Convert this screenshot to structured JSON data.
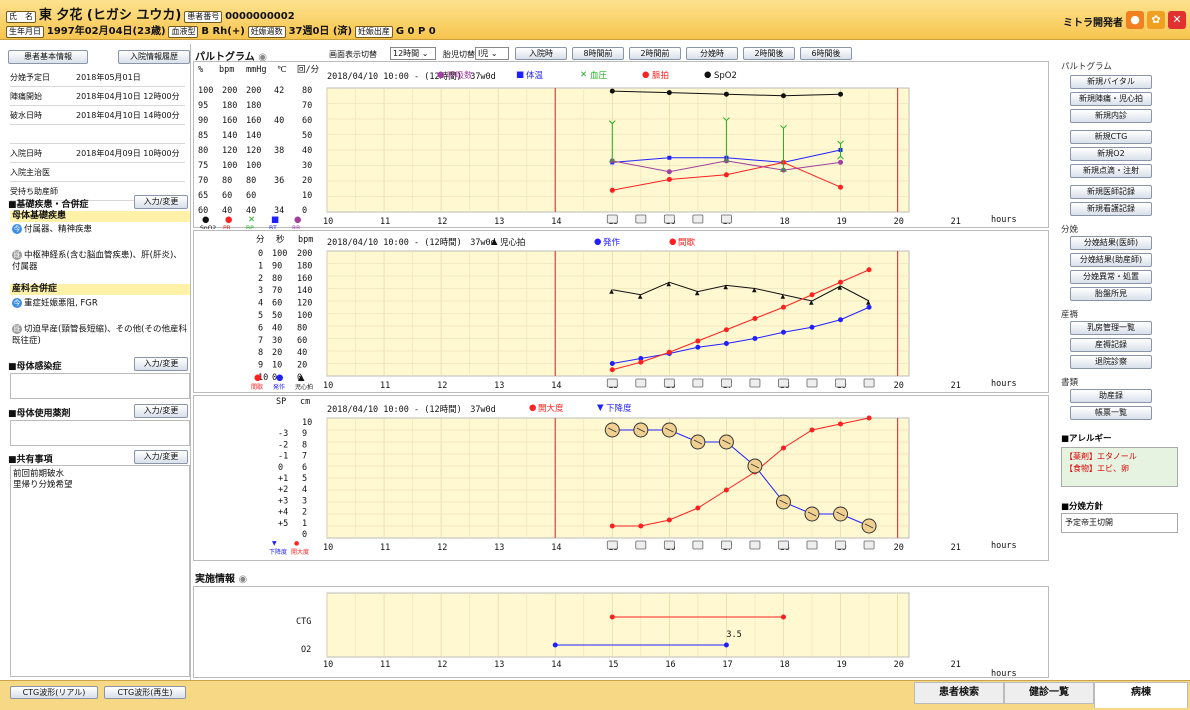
{
  "header": {
    "name_tag": "氏　名",
    "name": "東 夕花 (ヒガシ ユウカ)",
    "patient_no_tag": "患者番号",
    "patient_no": "0000000002",
    "dob_tag": "生年月日",
    "dob": "1997年02月04日(23歳)",
    "blood_tag": "血液型",
    "blood": "B Rh(+)",
    "weeks_tag": "妊娠週数",
    "weeks": "37週0日 (済)",
    "parity_tag": "妊娠出産",
    "parity": "G 0 P 0",
    "user": "ミトラ開発者"
  },
  "left": {
    "btn_basic": "患者基本情報",
    "btn_history": "入院情報履歴",
    "info": [
      {
        "label": "分娩予定日",
        "value": "2018年05月01日"
      },
      {
        "label": "陣痛開始",
        "value": "2018年04月10日 12時00分"
      },
      {
        "label": "破水日時",
        "value": "2018年04月10日 14時00分"
      },
      {
        "label": "",
        "value": ""
      },
      {
        "label": "入院日時",
        "value": "2018年04月09日 10時00分"
      },
      {
        "label": "入院主治医",
        "value": ""
      },
      {
        "label": "受持ち助産師",
        "value": ""
      }
    ],
    "sec_disease": "■基礎疾患・合併症",
    "btn_edit": "入力/変更",
    "maternal_title": "母体基礎疾患",
    "maternal_1": "付属器、精神疾患",
    "maternal_2": "中枢神経系(含む脳血管疾患)、肝(肝炎)、付属器",
    "obst_title": "産科合併症",
    "obst_1": "重症妊娠悪阻, FGR",
    "obst_2": "切迫早産(頸管長短縮)、その他(その他産科既往症)",
    "sec_infection": "■母体感染症",
    "sec_drug": "■母体使用薬剤",
    "sec_shared": "■共有事項",
    "shared_1": "前回前期破水",
    "shared_2": "里帰り分娩希望",
    "ic_now": "今",
    "ic_past": "既"
  },
  "toolbar": {
    "title": "パルトグラム",
    "range_label": "画面表示切替",
    "range_value": "12時間",
    "fetal_label": "胎児切替",
    "fetal_value": "Ⅰ児",
    "buttons": [
      "入院時",
      "8時間前",
      "2時間前",
      "分娩時",
      "2時間後",
      "6時間後"
    ]
  },
  "chart_common": {
    "header": "2018/04/10 10:00 - (12時間)　37w0d",
    "xticks": [
      "10",
      "11",
      "12",
      "13",
      "14",
      "15",
      "16",
      "17",
      "18",
      "19",
      "20",
      "21"
    ],
    "hours": "hours"
  },
  "chart_data": [
    {
      "type": "line",
      "legend": [
        "呼吸数",
        "体温",
        "血圧",
        "脈拍",
        "SpO2"
      ],
      "axes_units": [
        "%",
        "bpm",
        "mmHg",
        "℃",
        "回/分"
      ],
      "axis_spo2": [
        "100",
        "95",
        "90",
        "85",
        "80",
        "75",
        "70",
        "65",
        "60"
      ],
      "axis_pr": [
        "200",
        "180",
        "160",
        "140",
        "120",
        "100",
        "80",
        "60",
        "40"
      ],
      "axis_bp": [
        "200",
        "180",
        "160",
        "140",
        "120",
        "100",
        "80",
        "60",
        "40"
      ],
      "axis_bt": [
        "42",
        "",
        "40",
        "",
        "38",
        "",
        "36",
        "",
        "34"
      ],
      "axis_rr": [
        "80",
        "70",
        "60",
        "50",
        "40",
        "30",
        "20",
        "10",
        "0"
      ],
      "bottom_legend": [
        "SpO2",
        "PR",
        "BP",
        "BT",
        "RR"
      ],
      "x": [
        15,
        16,
        17,
        18,
        19
      ],
      "series": [
        {
          "name": "SpO2",
          "values": [
            99,
            98.5,
            98,
            97.5,
            98
          ]
        },
        {
          "name": "体温",
          "values": [
            37.2,
            37.5,
            37.5,
            37.2,
            38.0
          ]
        },
        {
          "name": "脈拍",
          "values": [
            14,
            21,
            24,
            32,
            16
          ]
        },
        {
          "name": "呼吸数",
          "values": [
            33,
            26,
            33,
            27,
            32
          ]
        },
        {
          "name": "血圧",
          "values": [
            [
              154,
              108
            ],
            [
              null,
              null
            ],
            [
              158,
              108
            ],
            [
              148,
              96
            ],
            [
              128,
              112
            ]
          ]
        }
      ],
      "ylim_rr": [
        0,
        80
      ]
    },
    {
      "type": "line",
      "legend": [
        "児心拍",
        "発作",
        "間歇"
      ],
      "axes_units": [
        "分",
        "秒",
        "bpm"
      ],
      "axis_min": [
        "0",
        "1",
        "2",
        "3",
        "4",
        "5",
        "6",
        "7",
        "8",
        "9",
        "10"
      ],
      "axis_sec": [
        "100",
        "90",
        "80",
        "70",
        "60",
        "50",
        "40",
        "30",
        "20",
        "10",
        "0"
      ],
      "axis_bpm": [
        "200",
        "180",
        "160",
        "140",
        "120",
        "100",
        "80",
        "60",
        "40",
        "20",
        "0"
      ],
      "bottom_legend": [
        "間歇",
        "発作",
        "児心拍"
      ],
      "x": [
        15,
        15.5,
        16,
        16.5,
        17,
        17.5,
        18,
        18.5,
        19,
        19.5
      ],
      "series": [
        {
          "name": "児心拍",
          "values": [
            138,
            130,
            150,
            135,
            145,
            140,
            130,
            120,
            144,
            120
          ]
        },
        {
          "name": "発作",
          "values": [
            20,
            28,
            36,
            46,
            52,
            60,
            70,
            78,
            90,
            110
          ]
        },
        {
          "name": "間歇",
          "values": [
            10,
            22,
            38,
            56,
            74,
            92,
            110,
            130,
            150,
            170
          ]
        }
      ],
      "ylim": [
        0,
        200
      ]
    },
    {
      "type": "line",
      "legend": [
        "開大度",
        "下降度"
      ],
      "axes_units": [
        "SP",
        "cm"
      ],
      "axis_sp": [
        "",
        "-3",
        "-2",
        "-1",
        "0",
        "+1",
        "+2",
        "+3",
        "+4",
        "+5",
        ""
      ],
      "axis_cm": [
        "10",
        "9",
        "8",
        "7",
        "6",
        "5",
        "4",
        "3",
        "2",
        "1",
        "0"
      ],
      "bottom_legend": [
        "下降度",
        "開大度"
      ],
      "x": [
        15,
        15.5,
        16,
        16.5,
        17,
        17.5,
        18,
        18.5,
        19,
        19.5
      ],
      "series": [
        {
          "name": "開大度",
          "values": [
            1,
            1,
            1.5,
            2.5,
            4,
            5.5,
            7.5,
            9,
            9.5,
            10
          ]
        },
        {
          "name": "下降度",
          "values": [
            -3,
            -3,
            -3,
            -2,
            -2,
            0,
            3,
            4,
            4,
            5
          ]
        }
      ],
      "ylim": [
        0,
        10
      ]
    }
  ],
  "jisshi": {
    "title": "実施情報",
    "rows": [
      "CTG",
      "O2"
    ],
    "o2_value": "3.5"
  },
  "right": {
    "sec_parto": "パルトグラム",
    "parto_btns": [
      "新規バイタル",
      "新規陣痛・児心拍",
      "新規内診",
      "新規CTG",
      "新規O2",
      "新規点滴・注射",
      "新規医師記録",
      "新規看護記録"
    ],
    "sec_delivery": "分娩",
    "delivery_btns": [
      "分娩結果(医師)",
      "分娩結果(助産師)",
      "分娩異常・処置",
      "胎盤所見"
    ],
    "sec_puer": "産褥",
    "puer_btns": [
      "乳房管理一覧",
      "産褥記録",
      "退院診察"
    ],
    "sec_docs": "書類",
    "docs_btns": [
      "助産録",
      "帳票一覧"
    ],
    "allergy_title": "■アレルギー",
    "allergy_1": "【薬剤】エタノール",
    "allergy_2": "【食物】エビ、卵",
    "policy_title": "■分娩方針",
    "policy_value": "予定帝王切開"
  },
  "bottom": {
    "ctg_real": "CTG波形(リアル)",
    "ctg_play": "CTG波形(再生)",
    "tabs": [
      "患者検索",
      "健診一覧",
      "病棟"
    ]
  },
  "colors": {
    "accent": "#f7c54e",
    "plot_bg": "#fff8d1",
    "red": "#ff2020",
    "blue": "#2020ff",
    "purple": "#a040a0",
    "green": "#20b020"
  }
}
